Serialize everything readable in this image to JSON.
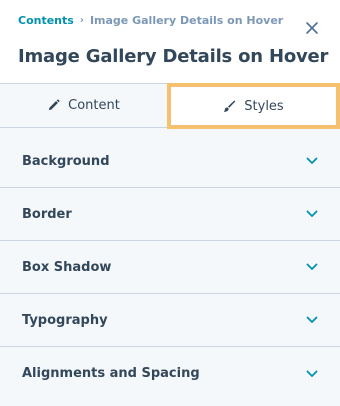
{
  "breadcrumb": {
    "link_label": "Contents",
    "separator": "›",
    "current_label": "Image Gallery Details on Hover"
  },
  "header": {
    "title": "Image Gallery Details on Hover"
  },
  "tabs": [
    {
      "label": "Content",
      "icon": "pencil-icon",
      "active": false
    },
    {
      "label": "Styles",
      "icon": "brush-icon",
      "active": true
    }
  ],
  "sections": [
    {
      "label": "Background"
    },
    {
      "label": "Border"
    },
    {
      "label": "Box Shadow"
    },
    {
      "label": "Typography"
    },
    {
      "label": "Alignments and Spacing"
    }
  ],
  "colors": {
    "accent": "#0091ae",
    "text": "#33475b",
    "muted": "#7c98b6",
    "panel_bg": "#f5f8fa",
    "active_tab_border": "#f5c26b"
  }
}
